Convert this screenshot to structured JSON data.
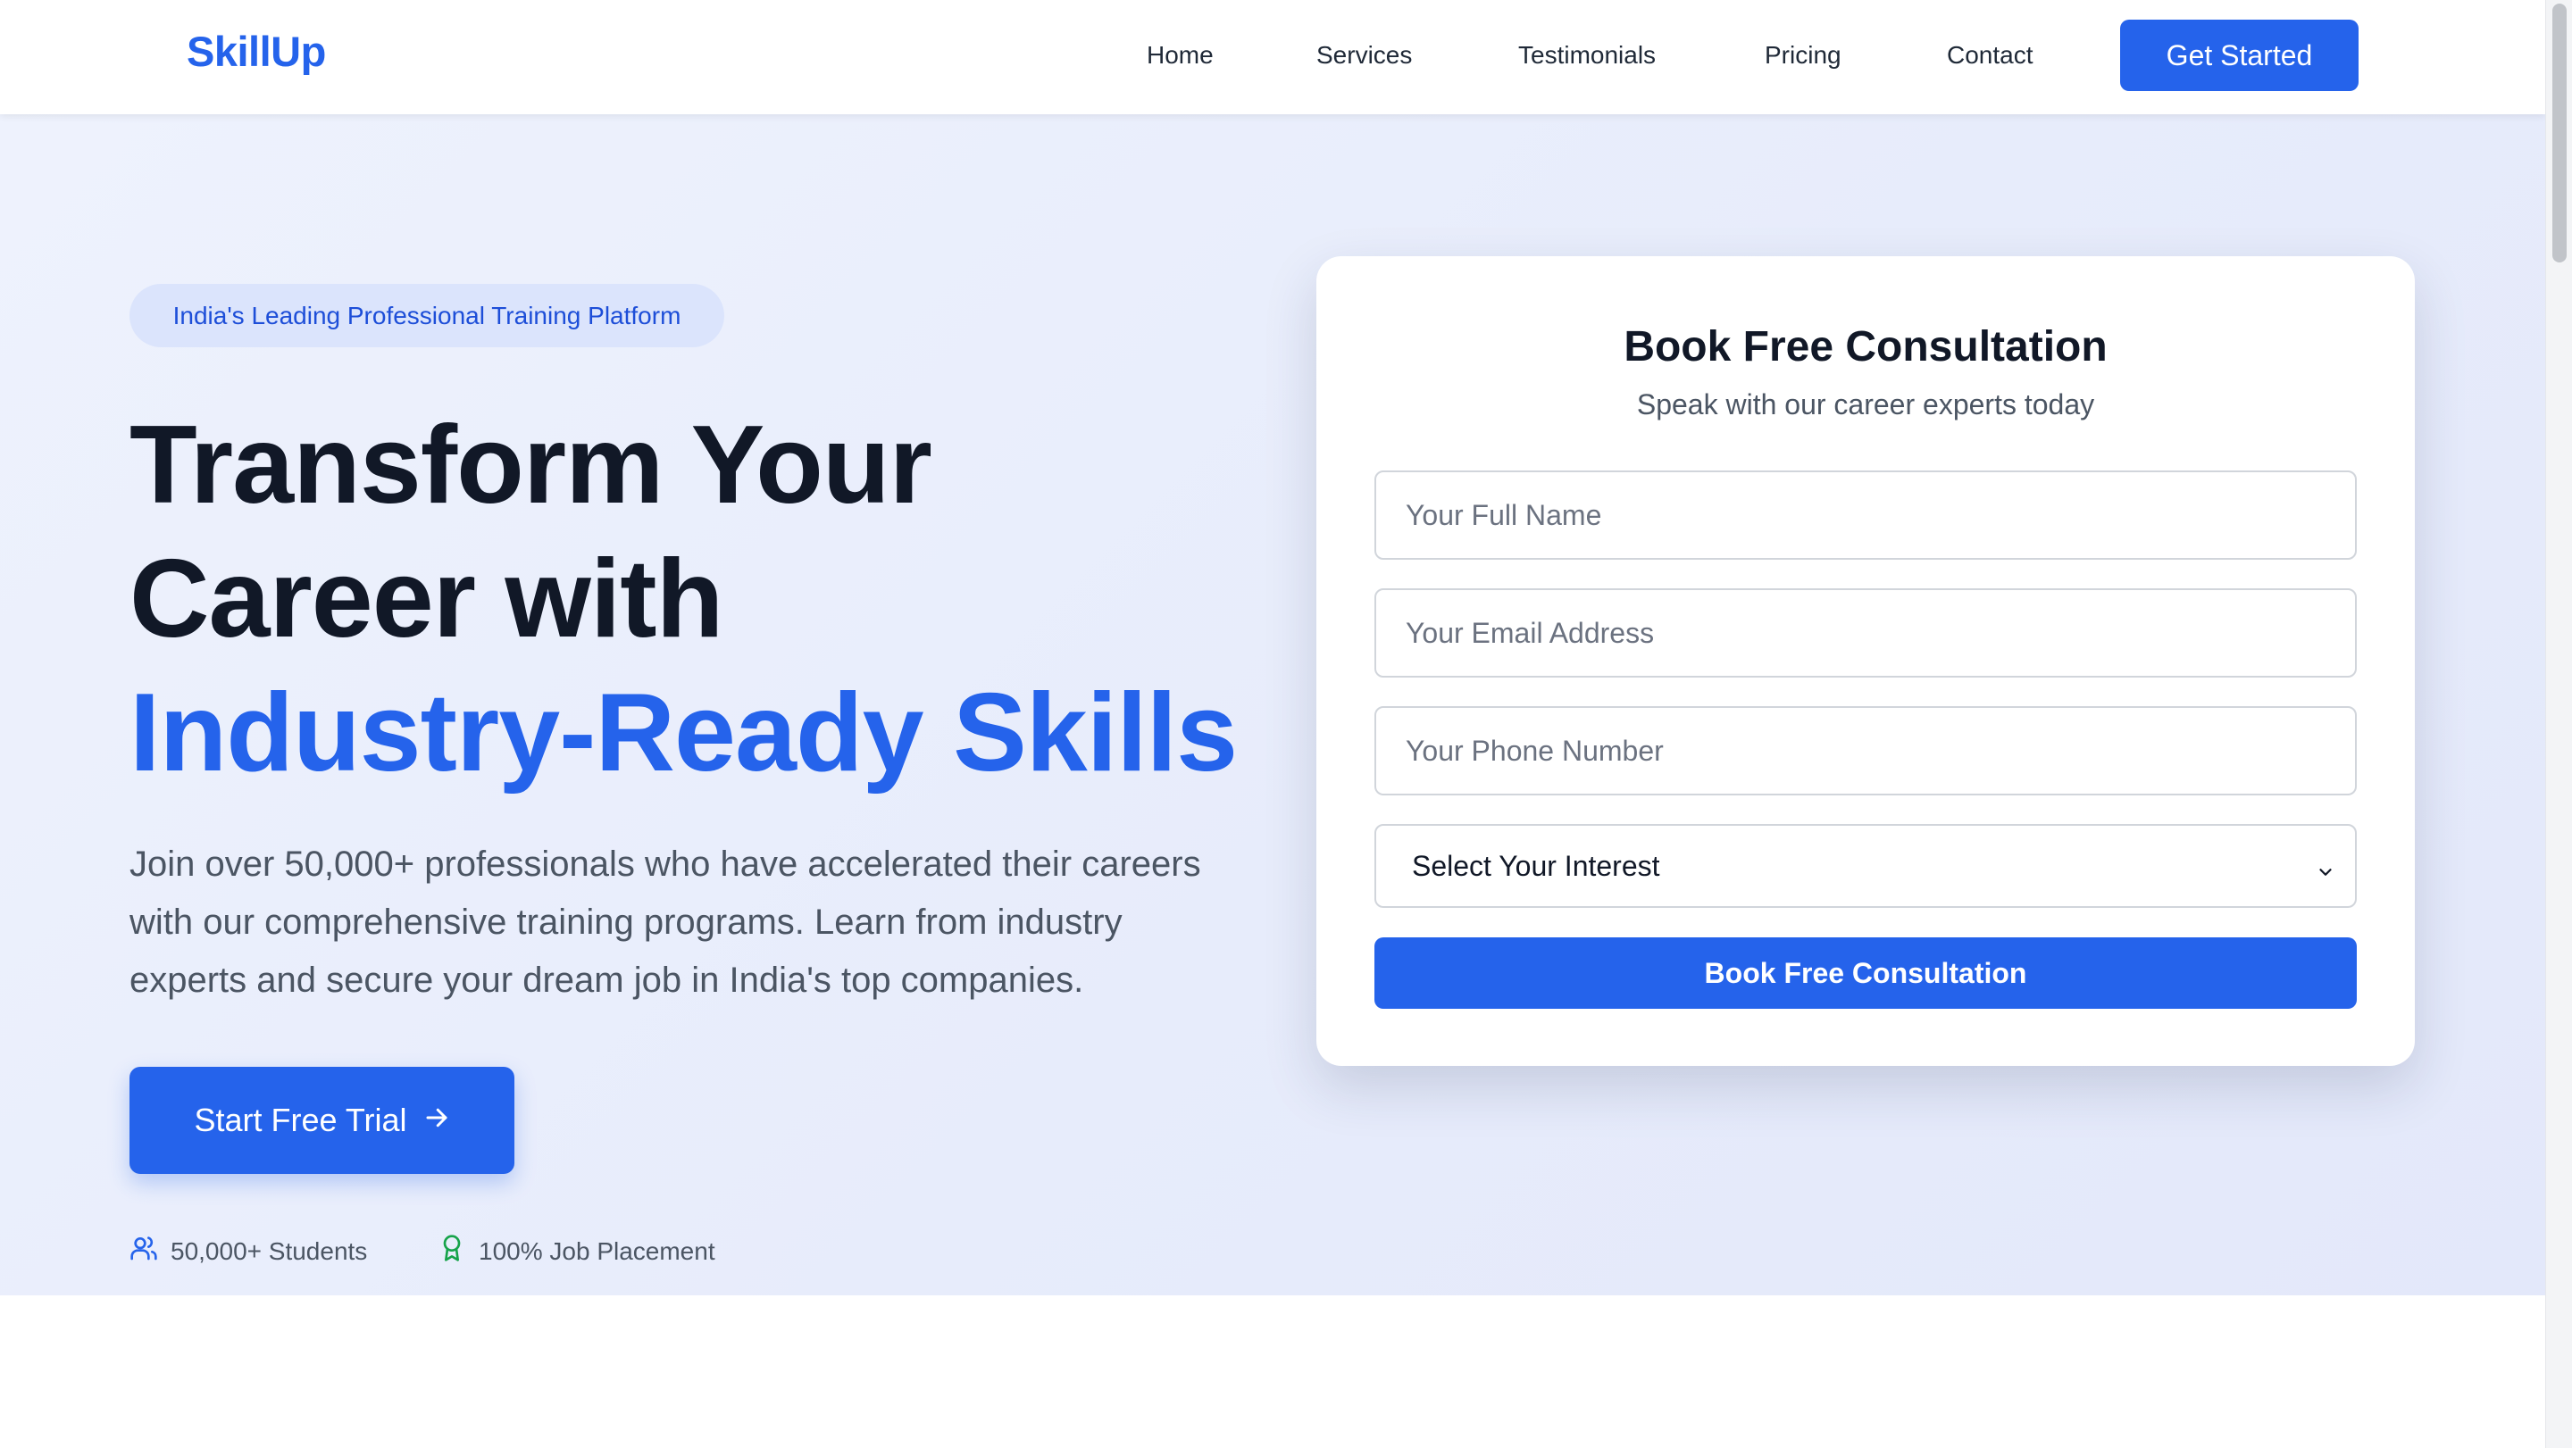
{
  "header": {
    "logo": "SkillUp",
    "nav": [
      "Home",
      "Services",
      "Testimonials",
      "Pricing",
      "Contact"
    ],
    "cta": "Get Started"
  },
  "hero": {
    "badge": "India's Leading Professional Training Platform",
    "headline": {
      "line1": "Transform Your",
      "line2": "Career with",
      "line3": "Industry-Ready Skills"
    },
    "description": "Join over 50,000+ professionals who have accelerated their careers with our comprehensive training programs. Learn from industry experts and secure your dream job in India's top companies.",
    "cta": "Start Free Trial",
    "stats": [
      {
        "icon": "users-icon",
        "label": "50,000+ Students"
      },
      {
        "icon": "award-icon",
        "label": "100% Job Placement"
      }
    ]
  },
  "form": {
    "title": "Book Free Consultation",
    "subtitle": "Speak with our career experts today",
    "name_placeholder": "Your Full Name",
    "email_placeholder": "Your Email Address",
    "phone_placeholder": "Your Phone Number",
    "interest_selected": "Select Your Interest",
    "submit": "Book Free Consultation"
  },
  "colors": {
    "primary": "#2563eb",
    "heading": "#111827",
    "body_text": "#4b5563",
    "success": "#16a34a"
  }
}
